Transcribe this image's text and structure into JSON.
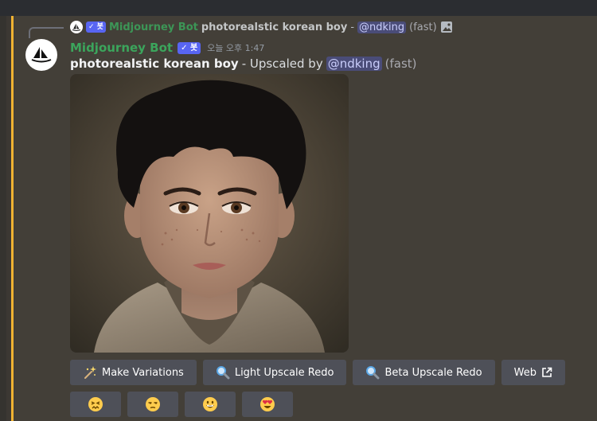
{
  "reply": {
    "bot_name": "Midjourney Bot",
    "badge": "✓ 봇",
    "prompt": "photorealstic korean boy",
    "separator": "-",
    "mention": "@ndking",
    "speed": "(fast)",
    "attachment_icon": "image-icon"
  },
  "message": {
    "author": "Midjourney Bot",
    "badge": "✓ 봇",
    "timestamp": "오늘 오후 1:47",
    "prompt": "photorealstic korean boy",
    "upscaled_by": "- Upscaled by",
    "mention": "@ndking",
    "speed": "(fast)",
    "avatar_icon": "midjourney-sailboat-icon"
  },
  "buttons": [
    {
      "label": "Make Variations",
      "icon": "sparkle-icon"
    },
    {
      "label": "Light Upscale Redo",
      "icon": "magnifier-icon"
    },
    {
      "label": "Beta Upscale Redo",
      "icon": "magnifier-icon"
    },
    {
      "label": "Web",
      "icon": "external-link-icon"
    }
  ],
  "reactions": [
    "confounded-face",
    "unamused-face",
    "grinning-face",
    "heart-eyes-face"
  ],
  "colors": {
    "accent": "#5865f2",
    "bot_name": "#3ba55c",
    "mention_bar": "#f0b232",
    "button": "#4e5058"
  }
}
